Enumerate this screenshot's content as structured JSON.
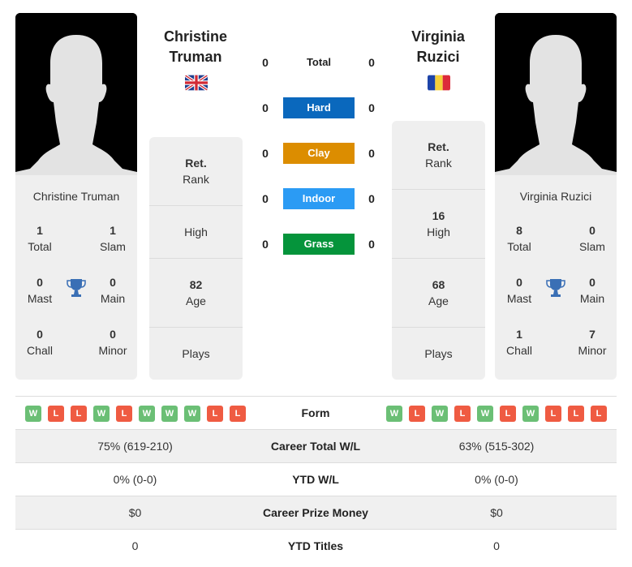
{
  "player1": {
    "name_line1": "Christine",
    "name_line2": "Truman",
    "full_name": "Christine Truman",
    "flag": "gb-flag",
    "titles": {
      "total": "1",
      "total_label": "Total",
      "slam": "1",
      "slam_label": "Slam",
      "mast": "0",
      "mast_label": "Mast",
      "main": "0",
      "main_label": "Main",
      "chall": "0",
      "chall_label": "Chall",
      "minor": "0",
      "minor_label": "Minor"
    },
    "rank_value": "Ret.",
    "rank_label": "Rank",
    "high_value": "",
    "high_label": "High",
    "age_value": "82",
    "age_label": "Age",
    "plays_value": "",
    "plays_label": "Plays",
    "form": [
      "W",
      "L",
      "L",
      "W",
      "L",
      "W",
      "W",
      "W",
      "L",
      "L"
    ],
    "career_wl": "75% (619-210)",
    "ytd_wl": "0% (0-0)",
    "prize_money": "$0",
    "ytd_titles": "0"
  },
  "player2": {
    "name_line1": "Virginia",
    "name_line2": "Ruzici",
    "full_name": "Virginia Ruzici",
    "flag": "ro-flag",
    "titles": {
      "total": "8",
      "total_label": "Total",
      "slam": "0",
      "slam_label": "Slam",
      "mast": "0",
      "mast_label": "Mast",
      "main": "0",
      "main_label": "Main",
      "chall": "1",
      "chall_label": "Chall",
      "minor": "7",
      "minor_label": "Minor"
    },
    "rank_value": "Ret.",
    "rank_label": "Rank",
    "high_value": "16",
    "high_label": "High",
    "age_value": "68",
    "age_label": "Age",
    "plays_value": "",
    "plays_label": "Plays",
    "form": [
      "W",
      "L",
      "W",
      "L",
      "W",
      "L",
      "W",
      "L",
      "L",
      "L"
    ],
    "career_wl": "63% (515-302)",
    "ytd_wl": "0% (0-0)",
    "prize_money": "$0",
    "ytd_titles": "0"
  },
  "h2h": {
    "total": {
      "label": "Total",
      "p1": "0",
      "p2": "0"
    },
    "surfaces": [
      {
        "label": "Hard",
        "p1": "0",
        "p2": "0",
        "color": "#0a68bd"
      },
      {
        "label": "Clay",
        "p1": "0",
        "p2": "0",
        "color": "#dc8d00"
      },
      {
        "label": "Indoor",
        "p1": "0",
        "p2": "0",
        "color": "#2b9bf4"
      },
      {
        "label": "Grass",
        "p1": "0",
        "p2": "0",
        "color": "#05943b"
      }
    ]
  },
  "table": {
    "form_label": "Form",
    "career_wl_label": "Career Total W/L",
    "ytd_wl_label": "YTD W/L",
    "prize_money_label": "Career Prize Money",
    "ytd_titles_label": "YTD Titles"
  },
  "colors": {
    "win": "#6bbf75",
    "loss": "#ef5b42",
    "trophy": "#3a6fb5"
  }
}
